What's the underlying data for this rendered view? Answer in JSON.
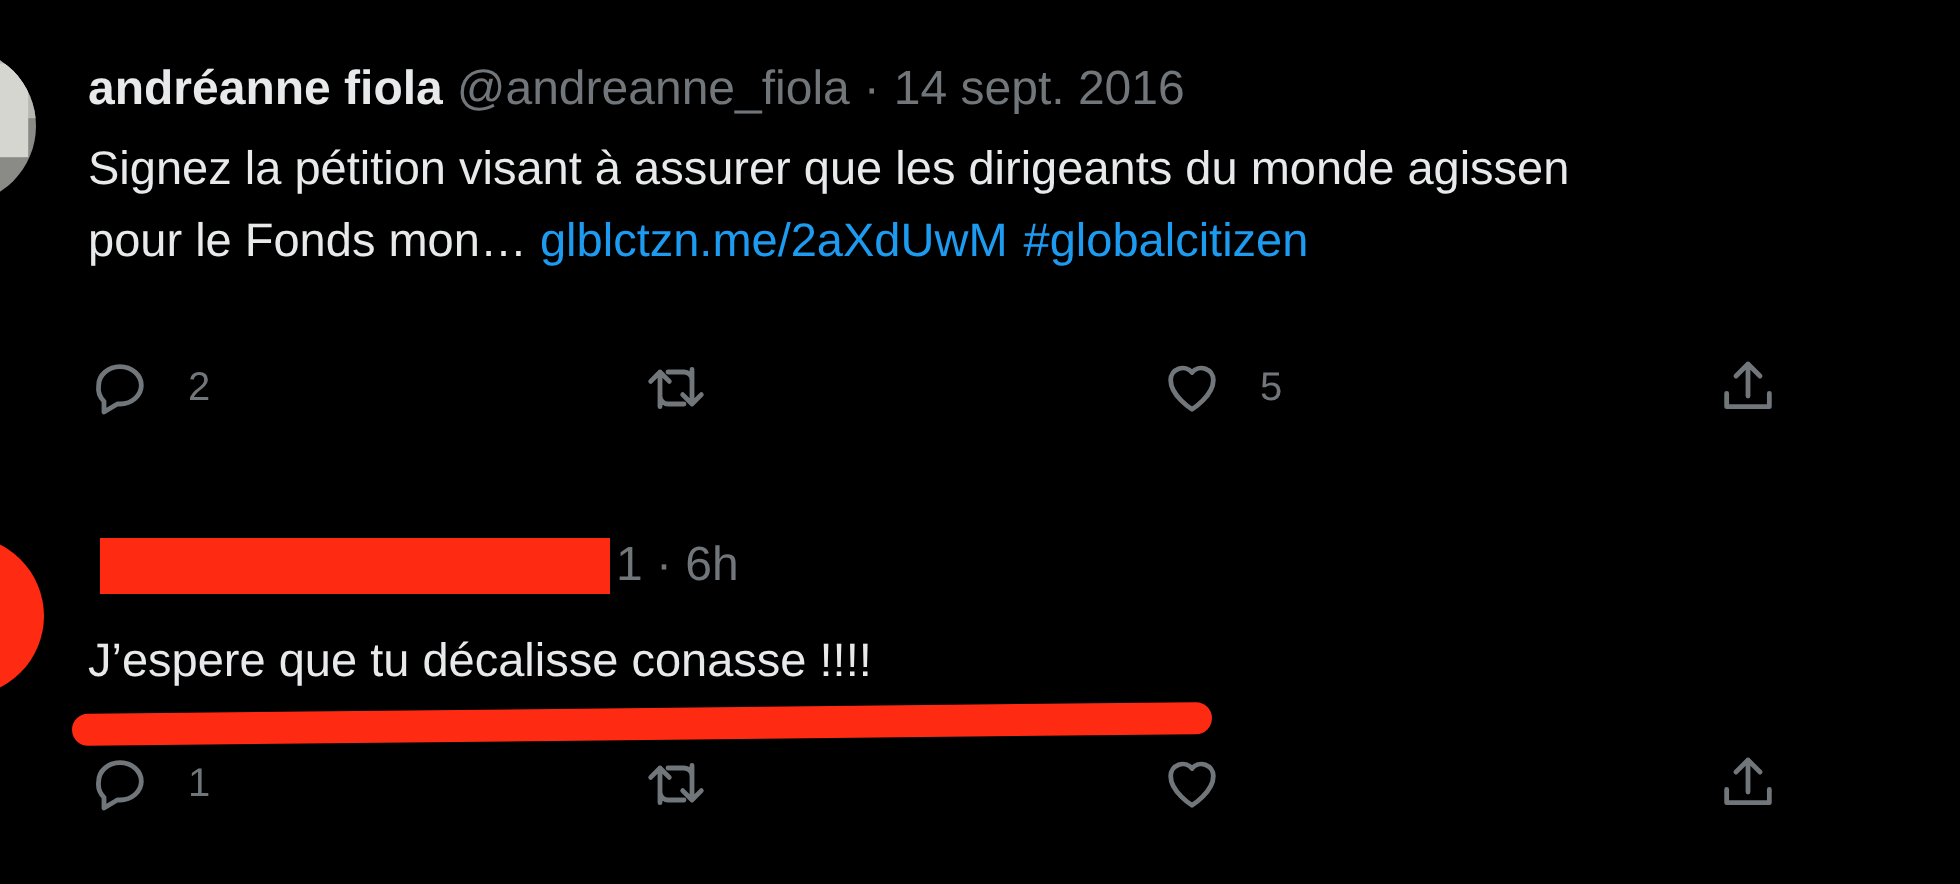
{
  "tweets": [
    {
      "kind": "original",
      "name": "andréanne fiola",
      "handle": "@andreanne_fiola",
      "separator": "·",
      "time": "14 sept. 2016",
      "lines": [
        {
          "parts": [
            {
              "kind": "text",
              "text": "Signez la pétition visant à assurer que les dirigeants du monde agissen"
            }
          ]
        },
        {
          "parts": [
            {
              "kind": "text",
              "text": "pour le Fonds mon… "
            },
            {
              "kind": "link",
              "text": "glblctzn.me/2aXdUwM"
            },
            {
              "kind": "link",
              "text": "#globalcitizen"
            }
          ]
        }
      ],
      "replies": "2",
      "likes": "5"
    },
    {
      "kind": "redacted",
      "time": "1 · 6h",
      "lines": [
        {
          "parts": [
            {
              "kind": "text",
              "text": "J’espere que tu décalisse conasse !!!!"
            }
          ]
        }
      ],
      "replies": "1"
    }
  ]
}
